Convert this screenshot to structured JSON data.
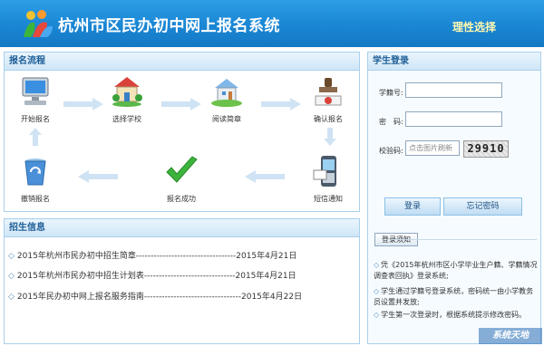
{
  "header": {
    "title": "杭州市区民办初中网上报名系统",
    "slogan": "理性选择"
  },
  "process": {
    "heading": "报名流程",
    "steps": {
      "start": "开始报名",
      "choose": "选择学校",
      "read": "阅读简章",
      "confirm": "确认报名",
      "sms": "短信通知",
      "success": "报名成功",
      "cancel": "撤销报名"
    }
  },
  "news": {
    "heading": "招生信息",
    "items": [
      {
        "text": "2015年杭州市民办初中招生简章----------------------------------2015年4月21日"
      },
      {
        "text": "2015年杭州市民办初中招生计划表-------------------------------2015年4月21日"
      },
      {
        "text": "2015年民办初中网上报名服务指南---------------------------------2015年4月22日"
      }
    ]
  },
  "login": {
    "heading": "学生登录",
    "student_id_label": "学籍号:",
    "password_label": "密　码:",
    "captcha_label": "校验码:",
    "captcha_placeholder": "点击图片刷新",
    "captcha_text": "29910",
    "login_button": "登录",
    "forgot_button": "忘记密码"
  },
  "notice": {
    "tab": "登录须知",
    "items": [
      "凭《2015年杭州市区小学毕业生户籍、学籍情况调查表回执》登录系统;",
      "学生通过学籍号登录系统，密码统一由小学教务员设置并发放;",
      "学生第一次登录时，根据系统提示修改密码。"
    ]
  },
  "watermark": "系统天地",
  "colors": {
    "header": "#1a86d4",
    "panel_border": "#a9d0ec",
    "heading_text": "#1c5d96",
    "slogan": "#fff8b0"
  },
  "icons": [
    "logo-icon",
    "computer-icon",
    "school-icon",
    "house-icon",
    "stamp-icon",
    "phone-icon",
    "checkmark-icon",
    "recycle-bin-icon"
  ]
}
